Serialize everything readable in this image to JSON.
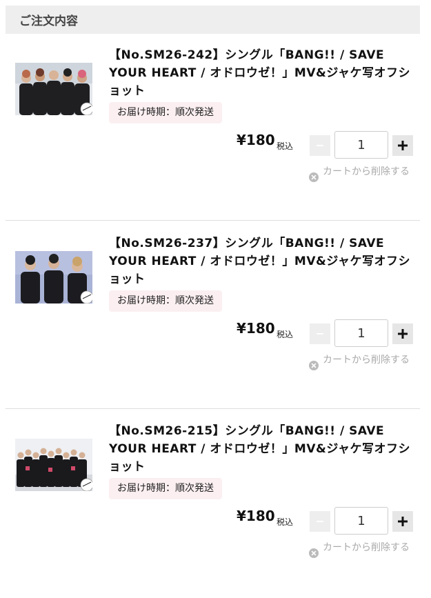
{
  "header": {
    "title": "ご注文内容"
  },
  "items": [
    {
      "title": "【No.SM26-242】シングル「BANG!! / SAVE YOUR HEART / オドロウゼ！」MV&ジャケ写オフショット",
      "delivery": "お届け時期：順次発送",
      "price": "¥180",
      "tax_label": "税込",
      "quantity": "1",
      "remove_label": "カートから削除する"
    },
    {
      "title": "【No.SM26-237】シングル「BANG!! / SAVE YOUR HEART / オドロウゼ！」MV&ジャケ写オフショット",
      "delivery": "お届け時期：順次発送",
      "price": "¥180",
      "tax_label": "税込",
      "quantity": "1",
      "remove_label": "カートから削除する"
    },
    {
      "title": "【No.SM26-215】シングル「BANG!! / SAVE YOUR HEART / オドロウゼ！」MV&ジャケ写オフショット",
      "delivery": "お届け時期：順次発送",
      "price": "¥180",
      "tax_label": "税込",
      "quantity": "1",
      "remove_label": "カートから削除する"
    }
  ],
  "colors": {
    "header_bg": "#eeeeee",
    "delivery_bg": "#fbeff1",
    "remove_text": "#aaaaaa",
    "divider": "#dddddd"
  }
}
